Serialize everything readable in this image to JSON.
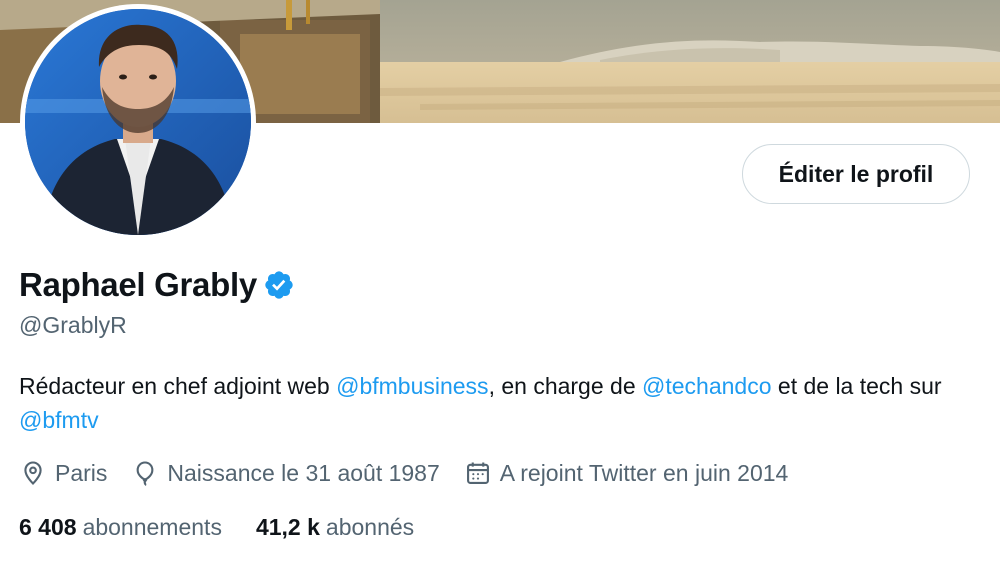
{
  "profile": {
    "name": "Raphael Grably",
    "handle": "@GrablyR",
    "verified": true,
    "edit_button": "Éditer le profil",
    "bio": {
      "part1": "Rédacteur en chef adjoint web ",
      "mention1": "@bfmbusiness",
      "part2": ", en charge de ",
      "mention2": "@techandco",
      "part3": " et de la tech sur ",
      "mention3": "@bfmtv"
    },
    "location": "Paris",
    "birthday": "Naissance le 31 août 1987",
    "joined": "A rejoint Twitter en juin 2014",
    "following": {
      "count": "6 408",
      "label": "abonnements"
    },
    "followers": {
      "count": "41,2 k",
      "label": "abonnés"
    }
  },
  "icons": {
    "location": "location-pin-icon",
    "birthday": "balloon-icon",
    "joined": "calendar-icon",
    "verified": "verified-badge-icon"
  },
  "colors": {
    "accent": "#1d9bf0",
    "text": "#0f1419",
    "secondary_text": "#536471",
    "border": "#cfd9de"
  }
}
